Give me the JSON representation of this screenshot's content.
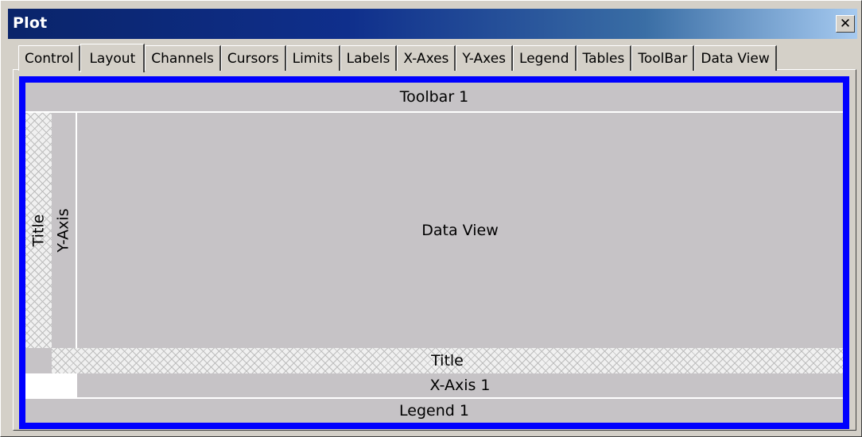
{
  "window": {
    "title": "Plot",
    "close_icon": "close-icon"
  },
  "tabs": [
    {
      "label": "Control"
    },
    {
      "label": "Layout",
      "active": true
    },
    {
      "label": "Channels"
    },
    {
      "label": "Cursors"
    },
    {
      "label": "Limits"
    },
    {
      "label": "Labels"
    },
    {
      "label": "X-Axes"
    },
    {
      "label": "Y-Axes"
    },
    {
      "label": "Legend"
    },
    {
      "label": "Tables"
    },
    {
      "label": "ToolBar"
    },
    {
      "label": "Data View"
    }
  ],
  "layout": {
    "toolbar": "Toolbar 1",
    "title_left": "Title",
    "y_axis": "Y-Axis",
    "data_view": "Data View",
    "title_bottom": "Title",
    "x_axis": "X-Axis 1",
    "legend": "Legend 1"
  },
  "colors": {
    "frame": "#0000ff",
    "title_bar_start": "#0a246a",
    "title_bar_end": "#a6caf0",
    "region": "#c6c3c6"
  }
}
